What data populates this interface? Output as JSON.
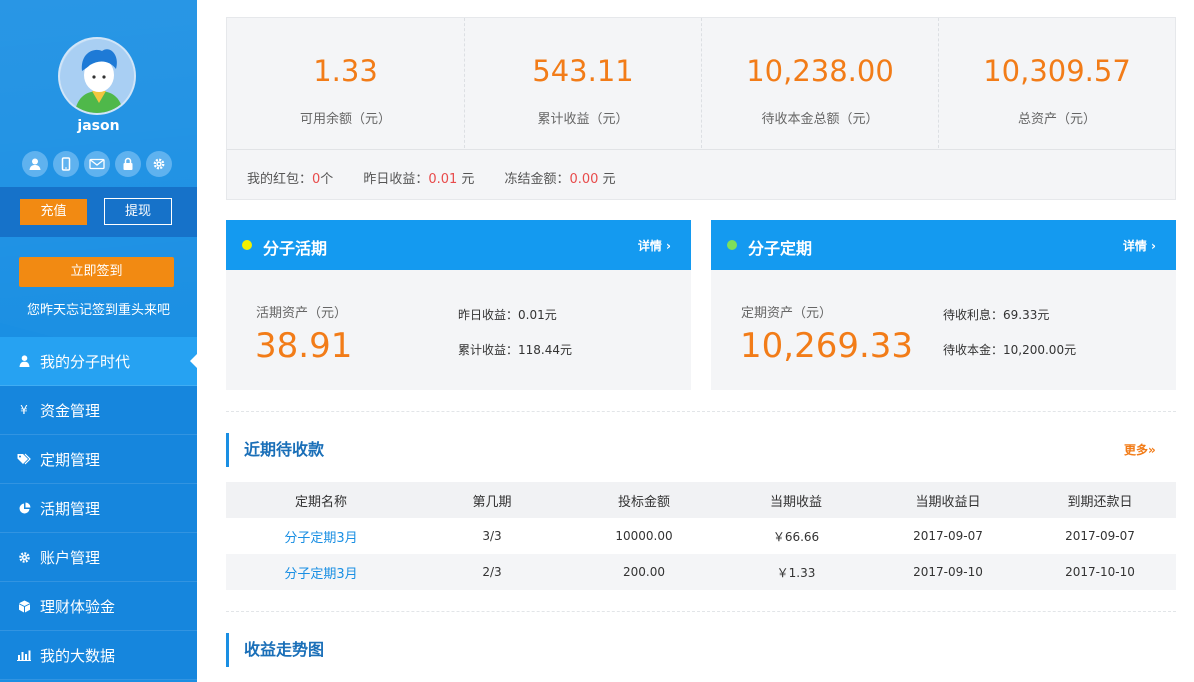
{
  "user": {
    "name": "jason"
  },
  "sidebar": {
    "charge_label": "充值",
    "withdraw_label": "提现",
    "sign_label": "立即签到",
    "sign_tip": "您昨天忘记签到重头来吧",
    "quick_icons": [
      "user-icon",
      "phone-icon",
      "mail-icon",
      "lock-icon",
      "gear-icon"
    ],
    "nav": [
      {
        "label": "我的分子时代",
        "icon": "user-icon"
      },
      {
        "label": "资金管理",
        "icon": "yen-icon"
      },
      {
        "label": "定期管理",
        "icon": "tag-icon"
      },
      {
        "label": "活期管理",
        "icon": "pie-chart-icon"
      },
      {
        "label": "账户管理",
        "icon": "gear-icon"
      },
      {
        "label": "理财体验金",
        "icon": "cube-icon"
      },
      {
        "label": "我的大数据",
        "icon": "bar-chart-icon"
      }
    ]
  },
  "summary": {
    "stats": [
      {
        "value": "1.33",
        "label": "可用余额（元）"
      },
      {
        "value": "543.11",
        "label": "累计收益（元）"
      },
      {
        "value": "10,238.00",
        "label": "待收本金总额（元）"
      },
      {
        "value": "10,309.57",
        "label": "总资产（元）"
      }
    ],
    "redpack_label": "我的红包：",
    "redpack_value": "0",
    "redpack_unit": "个",
    "yesterday_label": "昨日收益：",
    "yesterday_value": "0.01",
    "yesterday_unit": "元",
    "frozen_label": "冻结金额：",
    "frozen_value": "0.00",
    "frozen_unit": "元"
  },
  "current_card": {
    "title": "分子活期",
    "more": "详情 ›",
    "asset_label": "活期资产（元）",
    "asset_value": "38.91",
    "row1": "昨日收益：0.01元",
    "row2": "累计收益：118.44元",
    "dot_color": "#f4f000"
  },
  "fixed_card": {
    "title": "分子定期",
    "more": "详情 ›",
    "asset_label": "定期资产（元）",
    "asset_value": "10,269.33",
    "row1": "待收利息：69.33元",
    "row2": "待收本金：10,200.00元",
    "dot_color": "#7ee05a"
  },
  "receivables": {
    "title": "近期待收款",
    "more": "更多»",
    "headers": [
      "定期名称",
      "第几期",
      "投标金额",
      "当期收益",
      "当期收益日",
      "到期还款日"
    ],
    "rows": [
      [
        "分子定期3月",
        "3/3",
        "10000.00",
        "￥66.66",
        "2017-09-07",
        "2017-09-07"
      ],
      [
        "分子定期3月",
        "2/3",
        "200.00",
        "￥1.33",
        "2017-09-10",
        "2017-10-10"
      ]
    ]
  },
  "trend": {
    "title": "收益走势图"
  }
}
